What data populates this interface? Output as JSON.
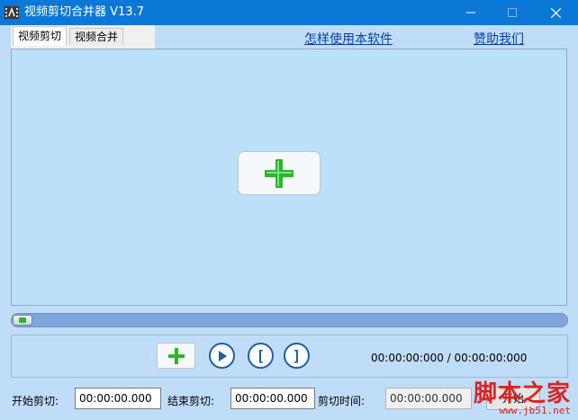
{
  "window": {
    "title": "视频剪切合并器 V13.7",
    "controls": {
      "minimize": "—",
      "maximize": "☐",
      "close": "✕"
    }
  },
  "tabs": [
    {
      "label": "视频剪切",
      "active": true
    },
    {
      "label": "视频合并",
      "active": false
    }
  ],
  "links": {
    "howto": "怎样使用本软件",
    "donate": "赞助我们"
  },
  "video": {
    "add_icon": "green-plus-icon"
  },
  "progress": {
    "position": 0
  },
  "controls": {
    "add_icon": "green-plus-icon",
    "play_icon": "play-icon",
    "mark_in_icon": "[",
    "mark_out_icon": "]",
    "time_readout": "00:00:00:000 / 00:00:00:000"
  },
  "form": {
    "start_label": "开始剪切:",
    "start_value": "00:00:00.000",
    "end_label": "结束剪切:",
    "end_value": "00:00:00.000",
    "duration_label": "剪切时间:",
    "duration_value": "00:00:00.000",
    "begin_button": "开始"
  },
  "watermark": {
    "text": "脚本之家",
    "url": "www.jb51.net"
  },
  "colors": {
    "titlebar": "#0b78d7",
    "background": "#bfdcf8",
    "link": "#0b3ea8",
    "plus_green": "#2db52d"
  }
}
